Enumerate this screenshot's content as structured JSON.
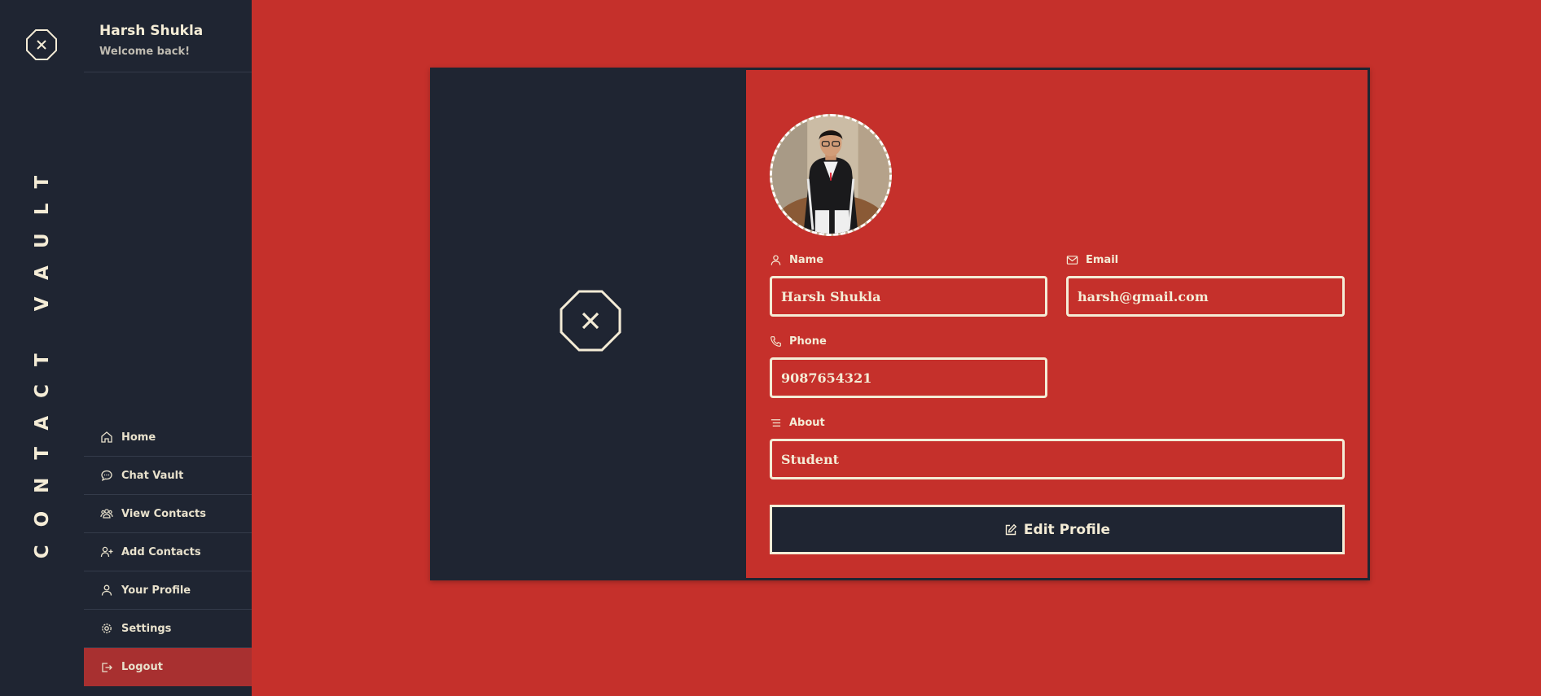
{
  "brand": {
    "name": "CONTACT VAULT",
    "logo_icon": "x-octagon-icon"
  },
  "user": {
    "name": "Harsh Shukla",
    "welcome": "Welcome back!"
  },
  "nav": [
    {
      "label": "Home",
      "icon": "home-icon"
    },
    {
      "label": "Chat Vault",
      "icon": "chat-icon"
    },
    {
      "label": "View Contacts",
      "icon": "users-icon"
    },
    {
      "label": "Add Contacts",
      "icon": "user-plus-icon"
    },
    {
      "label": "Your Profile",
      "icon": "user-icon"
    },
    {
      "label": "Settings",
      "icon": "gear-icon"
    },
    {
      "label": "Logout",
      "icon": "logout-icon",
      "active": true
    }
  ],
  "profile": {
    "name_label": "Name",
    "name_value": "Harsh Shukla",
    "email_label": "Email",
    "email_value": "harsh@gmail.com",
    "phone_label": "Phone",
    "phone_value": "9087654321",
    "about_label": "About",
    "about_value": "Student",
    "edit_label": "Edit Profile"
  },
  "colors": {
    "accent": "#c5302b",
    "dark": "#1f2532",
    "cream": "#f4ecd6",
    "logout_bg": "#a83030"
  }
}
